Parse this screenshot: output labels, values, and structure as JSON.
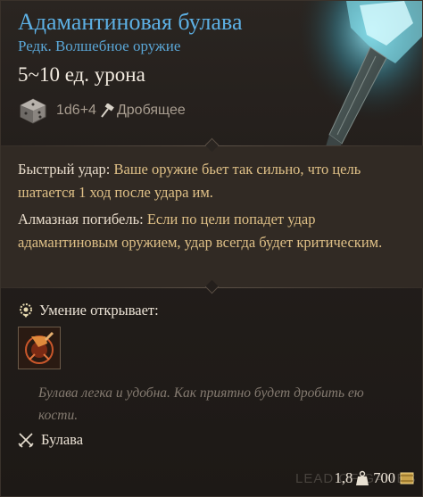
{
  "item": {
    "name": "Адамантиновая булава",
    "rarity_type": "Редк. Волшебное оружие",
    "damage": "5~10 ед. урона",
    "dice": "1d6+4",
    "damage_type": "Дробящее"
  },
  "passives": [
    {
      "name": "Быстрый удар:",
      "desc": "Ваше оружие бьет так сильно, что цель шатается 1 ход после удара им."
    },
    {
      "name": "Алмазная погибель:",
      "desc": "Если по цели попадет удар адамантиновым оружием, удар всегда будет критическим."
    }
  ],
  "unlocks": {
    "label": "Умение открывает:"
  },
  "flavor": "Булава легка и удобна. Как приятно будет дробить ею кости.",
  "category": "Булава",
  "footer": {
    "weight": "1,8",
    "value": "700"
  },
  "watermark": "LEAD OF GAMES",
  "colors": {
    "title": "#5db0e4",
    "passive_desc": "#dfc087",
    "flavor": "#857b71"
  }
}
